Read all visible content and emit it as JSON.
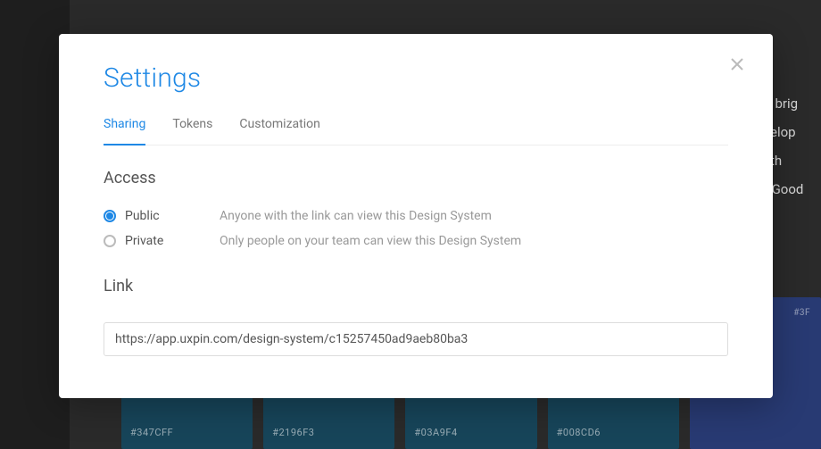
{
  "background": {
    "text_lines": "nd brig\nevelop\nwith\nS. Good",
    "swatches": [
      {
        "hex": "#347CFF"
      },
      {
        "hex": "#2196F3"
      },
      {
        "hex": "#03A9F4"
      },
      {
        "hex": "#008CD6"
      }
    ],
    "right_swatch_label": "#3F"
  },
  "modal": {
    "title": "Settings",
    "tabs": [
      {
        "label": "Sharing",
        "active": true
      },
      {
        "label": "Tokens",
        "active": false
      },
      {
        "label": "Customization",
        "active": false
      }
    ],
    "access": {
      "heading": "Access",
      "options": [
        {
          "value": "public",
          "label": "Public",
          "description": "Anyone with the link can view this Design System",
          "selected": true
        },
        {
          "value": "private",
          "label": "Private",
          "description": "Only people on your team can view this Design System",
          "selected": false
        }
      ]
    },
    "link": {
      "heading": "Link",
      "value": "https://app.uxpin.com/design-system/c15257450ad9aeb80ba3"
    }
  }
}
